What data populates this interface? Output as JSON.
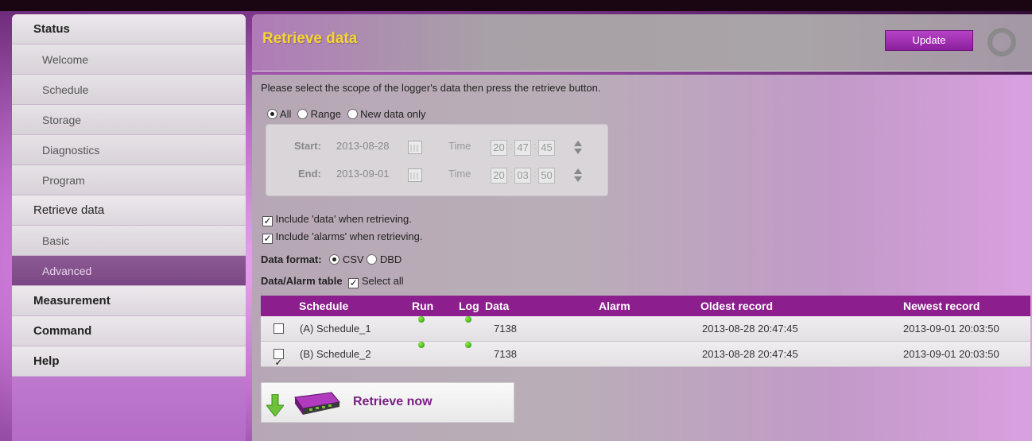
{
  "sidebar": {
    "items": [
      {
        "label": "Status",
        "kind": "section"
      },
      {
        "label": "Welcome",
        "kind": "sub"
      },
      {
        "label": "Schedule",
        "kind": "sub"
      },
      {
        "label": "Storage",
        "kind": "sub"
      },
      {
        "label": "Diagnostics",
        "kind": "sub"
      },
      {
        "label": "Program",
        "kind": "sub"
      },
      {
        "label": "Retrieve data",
        "kind": "section-normal"
      },
      {
        "label": "Basic",
        "kind": "sub"
      },
      {
        "label": "Advanced",
        "kind": "sub",
        "active": true
      },
      {
        "label": "Measurement",
        "kind": "section"
      },
      {
        "label": "Command",
        "kind": "section"
      },
      {
        "label": "Help",
        "kind": "section"
      }
    ]
  },
  "header": {
    "title": "Retrieve data",
    "update_label": "Update",
    "title_color": "#f8d432",
    "accent_color": "#8c1f8d"
  },
  "instruction": "Please select the scope of the logger's data then press the retrieve button.",
  "scope": {
    "options": [
      "All",
      "Range",
      "New data only"
    ],
    "selected": "All"
  },
  "range": {
    "start_label": "Start:",
    "start_date": "2013-08-28",
    "start_time": [
      "20",
      "47",
      "45"
    ],
    "end_label": "End:",
    "end_date": "2013-09-01",
    "end_time": [
      "20",
      "03",
      "50"
    ],
    "time_label": "Time"
  },
  "include": {
    "data_label": "Include 'data' when retrieving.",
    "data_checked": true,
    "alarms_label": "Include 'alarms' when retrieving.",
    "alarms_checked": true
  },
  "format": {
    "label": "Data format:",
    "options": [
      "CSV",
      "DBD"
    ],
    "selected": "CSV"
  },
  "table": {
    "label": "Data/Alarm table",
    "select_all_label": "Select all",
    "select_all_checked": true,
    "columns": [
      "Schedule",
      "Run",
      "Log",
      "Data",
      "Alarm",
      "Oldest record",
      "Newest record"
    ],
    "rows": [
      {
        "checked": false,
        "schedule": "(A) Schedule_1",
        "run": "green",
        "log": "green",
        "data": "7138",
        "alarm": "",
        "oldest": "2013-08-28 20:47:45",
        "newest": "2013-09-01 20:03:50"
      },
      {
        "checked": true,
        "schedule": "(B) Schedule_2",
        "run": "green",
        "log": "green",
        "data": "7138",
        "alarm": "",
        "oldest": "2013-08-28 20:47:45",
        "newest": "2013-09-01 20:03:50"
      }
    ]
  },
  "retrieve": {
    "label": "Retrieve now"
  }
}
